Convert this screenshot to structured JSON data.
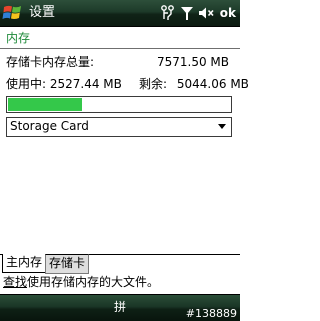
{
  "titlebar": {
    "title": "设置",
    "ok_label": "ok",
    "tray_icons": [
      "connectivity-icon",
      "signal-icon",
      "volume-muted-icon"
    ]
  },
  "header": {
    "title": "内存"
  },
  "storage": {
    "total_label": "存储卡内存总量:",
    "total_value": "7571.50 MB",
    "used_text": "使用中: 2527.44 MB",
    "free_label": "剩余:",
    "free_value": "5044.06 MB",
    "used_fraction": 0.334
  },
  "dropdown": {
    "selected": "Storage Card"
  },
  "tabs": [
    {
      "label": "主内存",
      "active": false
    },
    {
      "label": "存储卡",
      "active": true
    }
  ],
  "help": {
    "link": "查找",
    "text": "使用存储内存的大文件。"
  },
  "bottombar": {
    "softkey": "拼",
    "watermark": "#138889"
  },
  "colors": {
    "accent_green": "#1f8a3a",
    "progress_green": "#34c84a",
    "bar_dark": "#102317"
  }
}
